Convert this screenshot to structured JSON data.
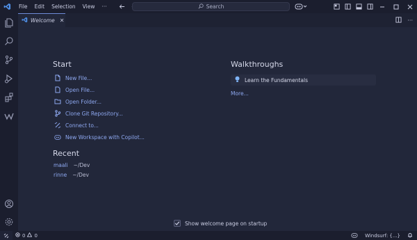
{
  "menu": {
    "items": [
      "File",
      "Edit",
      "Selection",
      "View",
      "···"
    ]
  },
  "search": {
    "label": "Search"
  },
  "tab": {
    "label": "Welcome",
    "close": "✕"
  },
  "welcome": {
    "start_title": "Start",
    "start_items": [
      {
        "label": "New File...",
        "icon": "new-file-icon"
      },
      {
        "label": "Open File...",
        "icon": "open-file-icon"
      },
      {
        "label": "Open Folder...",
        "icon": "open-folder-icon"
      },
      {
        "label": "Clone Git Repository...",
        "icon": "git-clone-icon"
      },
      {
        "label": "Connect to...",
        "icon": "remote-connect-icon"
      },
      {
        "label": "New Workspace with Copilot...",
        "icon": "copilot-icon"
      }
    ],
    "recent_title": "Recent",
    "recent": [
      {
        "name": "maali",
        "path": "~/Dev"
      },
      {
        "name": "rinne",
        "path": "~/Dev"
      }
    ],
    "walkthroughs_title": "Walkthroughs",
    "walkthrough_item": "Learn the Fundamentals",
    "more": "More...",
    "startup_label": "Show welcome page on startup",
    "startup_checked": true
  },
  "status": {
    "errors": "0",
    "warnings": "0",
    "windsurf": "Windsurf: {...}"
  },
  "colors": {
    "accent": "#6e8bd8",
    "link": "#8ea8f0",
    "background": "#22273a",
    "bar": "#1b1e2e"
  }
}
